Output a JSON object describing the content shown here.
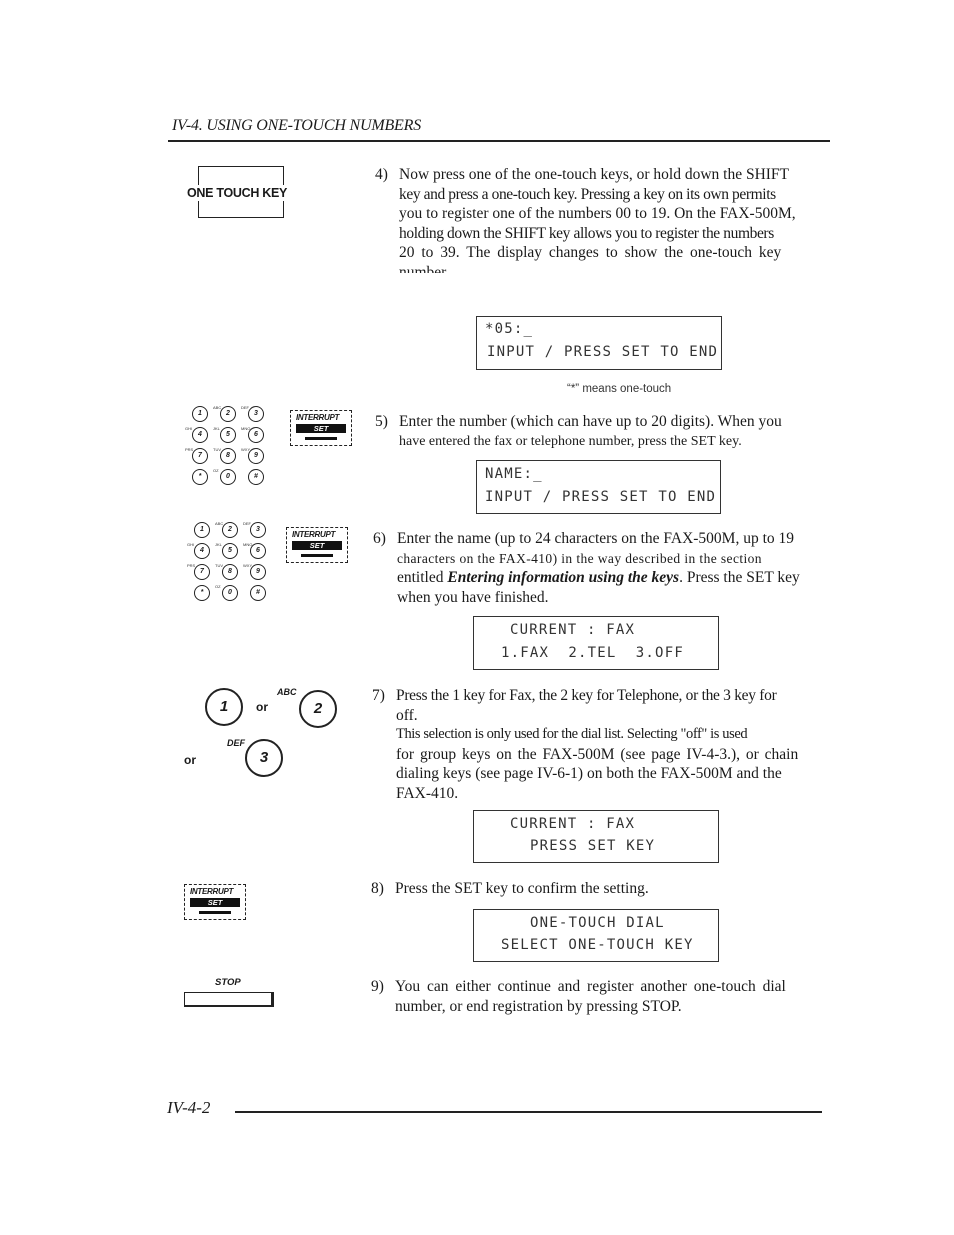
{
  "header": {
    "title": "IV-4. USING ONE-TOUCH NUMBERS"
  },
  "icons": {
    "one_touch_key": {
      "label": "ONE TOUCH KEY"
    },
    "interrupt_set": {
      "top": "INTERRUPT",
      "set": "SET"
    },
    "keypad": {
      "keys": [
        {
          "digit": "1",
          "letters": ""
        },
        {
          "digit": "2",
          "letters": "ABC"
        },
        {
          "digit": "3",
          "letters": "DEF"
        },
        {
          "digit": "4",
          "letters": "GHI"
        },
        {
          "digit": "5",
          "letters": "JKL"
        },
        {
          "digit": "6",
          "letters": "MNO"
        },
        {
          "digit": "7",
          "letters": "PRS"
        },
        {
          "digit": "8",
          "letters": "TUV"
        },
        {
          "digit": "9",
          "letters": "WXY"
        },
        {
          "digit": "*",
          "letters": ""
        },
        {
          "digit": "0",
          "letters": "OZ"
        },
        {
          "digit": "#",
          "letters": ""
        }
      ]
    },
    "choice_keys": {
      "key1": "1",
      "key2": "2",
      "key2_letters": "ABC",
      "key3": "3",
      "key3_letters": "DEF",
      "or": "or"
    },
    "stop": {
      "label": "STOP"
    }
  },
  "steps": [
    {
      "num": "4)",
      "lines": [
        "Now press one of the one-touch keys, or hold down the SHIFT",
        "key and press a one-touch key. Pressing a key on its own permits",
        "you to register one of the numbers 00 to 19. On the FAX-500M,",
        "holding down the SHIFT key allows you to register the numbers",
        "20 to 39. The display changes to show the one-touch key",
        "number"
      ],
      "display": [
        "*05:_",
        "INPUT / PRESS SET TO END"
      ],
      "caption": "“*” means one-touch"
    },
    {
      "num": "5)",
      "lines": [
        "Enter the number (which can have up to 20 digits). When you",
        "have entered the fax or telephone number, press the SET key."
      ],
      "display": [
        "NAME:_",
        "INPUT / PRESS SET TO END"
      ]
    },
    {
      "num": "6)",
      "lines": [
        "Enter the name (up to 24 characters on the FAX-500M, up to 19",
        "characters on the FAX-410) in the way described in the section"
      ],
      "line3_pre": "entitled ",
      "line3_em": "Entering information using the keys",
      "line3_post": ". Press the SET key",
      "line4": "when you have finished.",
      "display": [
        "CURRENT : FAX",
        "1.FAX  2.TEL  3.OFF"
      ]
    },
    {
      "num": "7)",
      "lines": [
        "Press the 1 key for Fax, the 2 key for Telephone, or the 3 key for",
        "off.",
        "This selection is only used for the dial list. Selecting \"off\" is used",
        "for group keys on the FAX-500M (see page IV-4-3.), or chain",
        "dialing keys (see page IV-6-1) on both the FAX-500M and the",
        "FAX-410."
      ],
      "display": [
        "CURRENT : FAX",
        "PRESS SET KEY"
      ]
    },
    {
      "num": "8)",
      "lines": [
        "Press the SET key to confirm the setting."
      ],
      "display": [
        "ONE-TOUCH DIAL",
        "SELECT ONE-TOUCH KEY"
      ]
    },
    {
      "num": "9)",
      "lines": [
        "You can either continue and register another one-touch dial",
        "number, or end registration by pressing STOP."
      ]
    }
  ],
  "footer": {
    "page_number": "IV-4-2"
  }
}
